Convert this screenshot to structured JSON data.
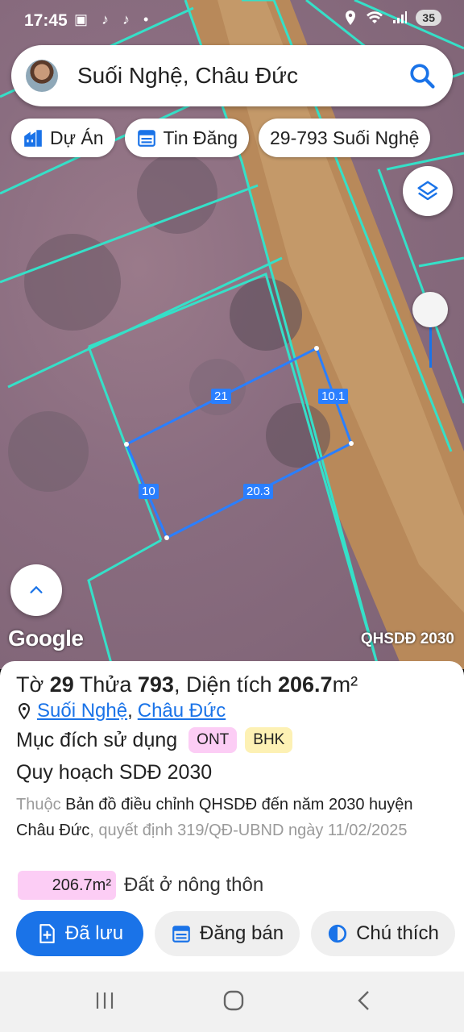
{
  "status": {
    "time": "17:45",
    "notif_icons": "▣ ♪ ♪ •",
    "battery": "35"
  },
  "search": {
    "query": "Suối Nghệ, Châu Đức"
  },
  "chips": [
    {
      "label": "Dự Án",
      "icon": "building-icon"
    },
    {
      "label": "Tin Đăng",
      "icon": "calendar-icon"
    },
    {
      "label": "29-793 Suối Nghệ",
      "icon": ""
    }
  ],
  "map": {
    "google_logo": "Google",
    "overlay_label": "QHSDĐ 2030",
    "edge_lengths": [
      "21",
      "10.1",
      "10",
      "20.3"
    ]
  },
  "parcel": {
    "sheet_prefix": "Tờ ",
    "sheet_no": "29",
    "plot_prefix": " Thửa ",
    "plot_no": "793",
    "area_prefix": ", Diện tích ",
    "area": "206.7",
    "area_unit": "m²",
    "commune": "Suối Nghệ",
    "district": "Châu Đức",
    "purpose_label": "Mục đích sử dụng",
    "purpose_codes": [
      "ONT",
      "BHK"
    ],
    "plan_title": "Quy hoạch SDĐ 2030",
    "plan_prefix": "Thuộc ",
    "plan_name": "Bản đồ điều chỉnh QHSDĐ đến năm 2030 huyện Châu Đức",
    "plan_decision": ", quyết định 319/QĐ-UBND ngày 11/02/2025",
    "zone_area": "206.7m²",
    "zone_label": "Đất ở nông thôn"
  },
  "actions": {
    "saved": "Đã lưu",
    "post_sale": "Đăng bán",
    "legend": "Chú thích"
  },
  "colors": {
    "accent": "#1a73e8",
    "ont_badge": "#fccdf5",
    "bhk_badge": "#fdf1b4",
    "parcel_line": "#35e0c8"
  }
}
